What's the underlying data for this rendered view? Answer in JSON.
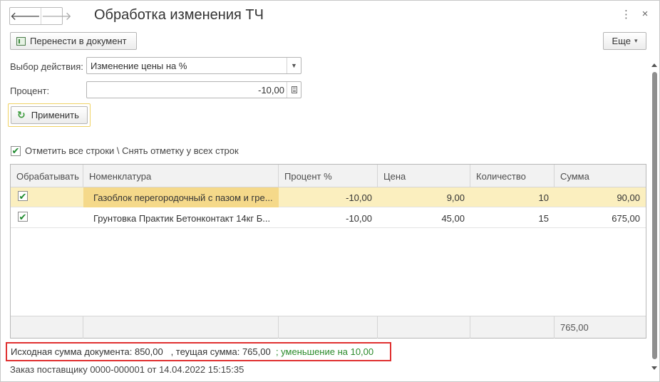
{
  "window": {
    "title": "Обработка изменения ТЧ",
    "nav_back_icon": "arrow-left-icon",
    "nav_forward_icon": "arrow-right-icon",
    "menu_icon_glyph": "⋮",
    "close_icon_glyph": "×"
  },
  "toolbar": {
    "move_label": "Перенести в документ",
    "more_label": "Еще",
    "more_arrow": "▾"
  },
  "form": {
    "action_label": "Выбор действия:",
    "action_value": "Изменение цены на %",
    "percent_label": "Процент:",
    "percent_value": "-10,00",
    "apply_label": "Применить",
    "apply_icon": "↻"
  },
  "check_all": {
    "checked": true,
    "label": "Отметить все строки \\ Снять отметку у всех строк"
  },
  "table": {
    "columns": [
      "Обрабатывать",
      "Номенклатура",
      "Процент %",
      "Цена",
      "Количество",
      "Сумма"
    ],
    "rows": [
      {
        "process": true,
        "name": "Газоблок перегородочный с пазом и гре...",
        "percent": "-10,00",
        "price": "9,00",
        "qty": "10",
        "sum": "90,00",
        "selected": true
      },
      {
        "process": true,
        "name": "Грунтовка Практик Бетонконтакт 14кг Б...",
        "percent": "-10,00",
        "price": "45,00",
        "qty": "15",
        "sum": "675,00",
        "selected": false
      }
    ],
    "total_sum": "765,00"
  },
  "summary": {
    "part1": "Исходная сумма документа: 850,00   , теущая сумма: 765,00  ",
    "part2": "; уменьшение на 10,00"
  },
  "order_ref": "Заказ поставщику 0000-000001 от 14.04.2022 15:15:35",
  "colors": {
    "highlight_row": "#fbefbf",
    "highlight_cell": "#f5d98a",
    "summary_border": "#e03030",
    "decrease_text": "#2a8a2a",
    "check_green": "#1e8a2e"
  }
}
